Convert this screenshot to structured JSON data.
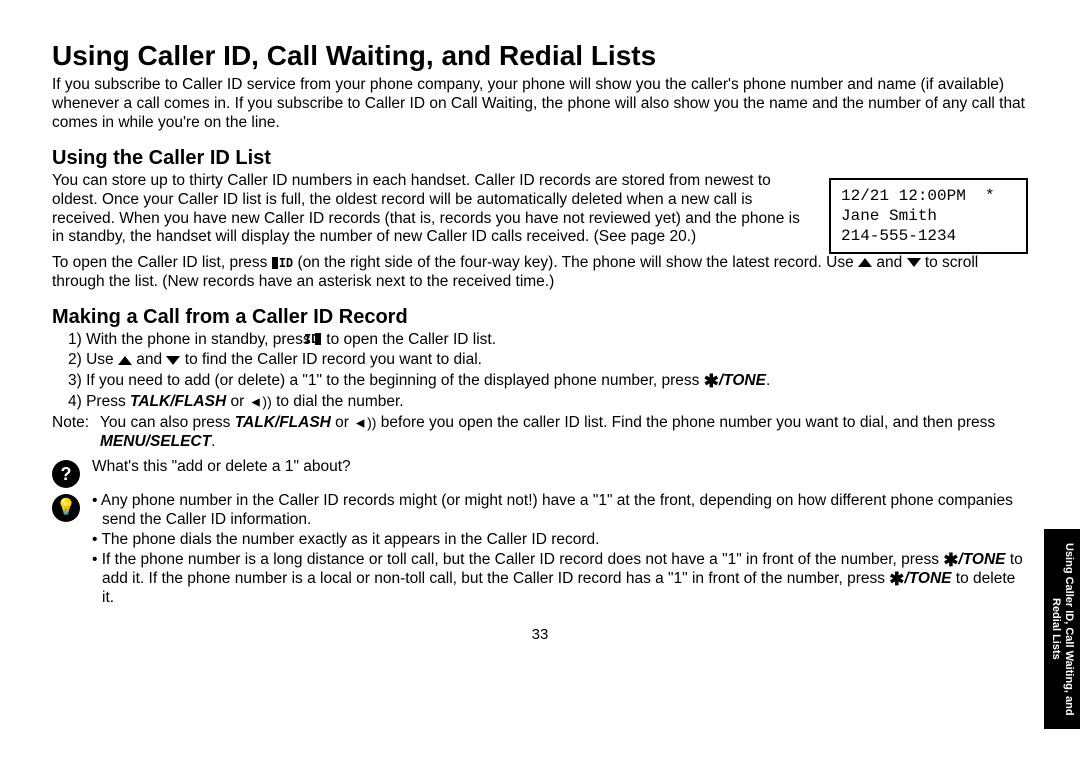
{
  "title": "Using Caller ID, Call Waiting, and Redial Lists",
  "intro": "If you subscribe to Caller ID service from your phone company, your phone will show you the caller's phone number and name (if available) whenever a call comes in. If you subscribe to Caller ID on Call Waiting, the phone will also show you the name and the number of any call that comes in while you're on the line.",
  "section1": {
    "heading": "Using the Caller ID List",
    "para1": "You can store up to thirty Caller ID numbers in each handset. Caller ID records are stored from newest to oldest. Once your Caller ID list is full, the oldest record will be automatically deleted when a new call is received. When you have new Caller ID records (that is, records you have not reviewed yet) and the phone is in standby, the handset will display the number of new Caller ID calls received. (See page 20.)",
    "lcd_line1": "12/21 12:00PM  *",
    "lcd_line2": "Jane Smith",
    "lcd_line3": "214-555-1234",
    "para2a": "To open the Caller ID list, press ",
    "para2b": " (on the right side of the four-way key). The phone will show the latest record. Use ",
    "para2c": " and ",
    "para2d": " to scroll through the list. (New records have an asterisk next to the received time.)"
  },
  "section2": {
    "heading": "Making a Call from a Caller ID Record",
    "step1a": "1) With the phone in standby, press ",
    "step1b": " to open the Caller ID list.",
    "step2a": "2) Use ",
    "step2b": " and ",
    "step2c": " to find the Caller ID record you want to dial.",
    "step3a": "3) If you need to add (or delete) a \"1\" to the beginning of the displayed phone number, press ",
    "step3b": ".",
    "step4a": "4) Press ",
    "step4b": " or ",
    "step4c": " to dial the number.",
    "noteLabel": "Note:",
    "noteA": "You can also press ",
    "noteB": " or ",
    "noteC": " before you open the caller ID list. Find the phone number you want to dial, and then press ",
    "noteD": ".",
    "talkflash": "TALK/FLASH",
    "tone": "/TONE",
    "menuselect": "MENU/SELECT",
    "hintQ": "What's this \"add or delete a 1\" about?",
    "bullet1": "Any phone number in the Caller ID records might (or might not!) have a \"1\" at the front, depending on how different phone companies send the Caller ID information.",
    "bullet2": "The phone dials the number exactly as it appears in the Caller ID record.",
    "bullet3a": "If the phone number is a long distance or toll call, but the Caller ID record does not have a \"1\" in front of the number, press ",
    "bullet3b": " to add it. If the phone number is a local or non-toll call, but the Caller ID record has a \"1\" in front of the number, press ",
    "bullet3c": " to delete it."
  },
  "sidetab": "Using Caller ID, Call Waiting, and Redial Lists",
  "pagenum": "33"
}
